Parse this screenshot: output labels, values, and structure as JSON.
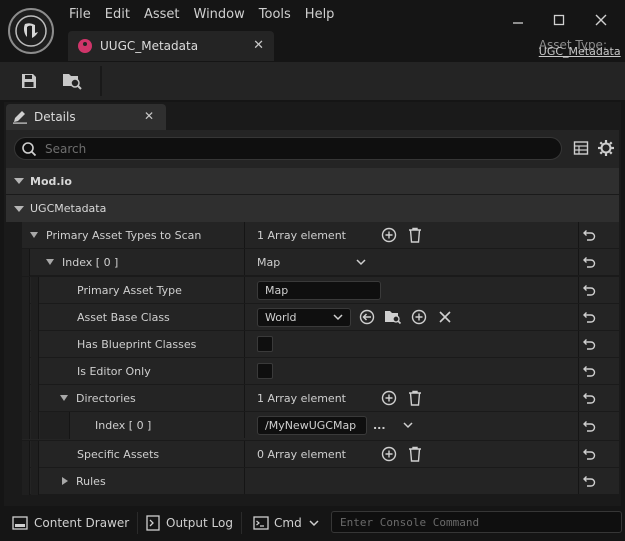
{
  "menu": [
    "File",
    "Edit",
    "Asset",
    "Window",
    "Tools",
    "Help"
  ],
  "document_tab": {
    "label": "UUGC_Metadata"
  },
  "asset_type": {
    "label": "Asset Type:",
    "value": "UGC_Metadata"
  },
  "details_tab": {
    "label": "Details"
  },
  "search": {
    "placeholder": "Search"
  },
  "categories": {
    "modio": "Mod.io",
    "ugc": "UGCMetadata"
  },
  "rows": {
    "primary_types": {
      "name": "Primary Asset Types to Scan",
      "value": "1 Array element"
    },
    "index0": {
      "name": "Index [ 0 ]",
      "value": "Map"
    },
    "primary_asset_type": {
      "name": "Primary Asset Type",
      "value": "Map"
    },
    "asset_base_class": {
      "name": "Asset Base Class",
      "value": "World"
    },
    "has_bp": {
      "name": "Has Blueprint Classes"
    },
    "editor_only": {
      "name": "Is Editor Only"
    },
    "directories": {
      "name": "Directories",
      "value": "1 Array element"
    },
    "dir_index0": {
      "name": "Index [ 0 ]",
      "value": "/MyNewUGCMap",
      "more": "..."
    },
    "specific_assets": {
      "name": "Specific Assets",
      "value": "0 Array element"
    },
    "rules": {
      "name": "Rules"
    }
  },
  "statusbar": {
    "content_drawer": "Content Drawer",
    "output_log": "Output Log",
    "cmd": "Cmd",
    "console_placeholder": "Enter Console Command"
  },
  "colors": {
    "accent": "#d0356a",
    "background": "#151515",
    "panel": "#242424",
    "header": "#2f2f2f"
  }
}
